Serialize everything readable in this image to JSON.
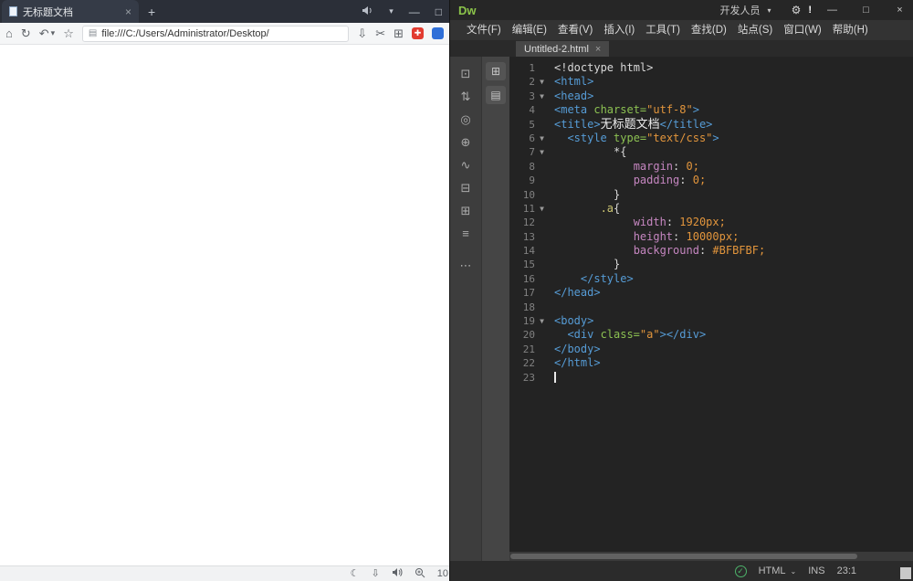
{
  "colors": {
    "dw_logo_green": "#8bc34a",
    "status_check_green": "#4db36a",
    "red_app_icon": "#e23b30",
    "blue_app_icon": "#2f6fd8",
    "browser_tabbar_bg": "#2b2f38",
    "code_background": "#232323"
  },
  "browser": {
    "tab": {
      "title": "无标题文档",
      "close_glyph": "×"
    },
    "new_tab_glyph": "+",
    "tabbar_icons": {
      "megaphone": "svg-megaphone-shape",
      "chevron": "▾",
      "minimize": "—",
      "maximize": "□"
    },
    "toolbar": {
      "icons": {
        "home": "⌂",
        "refresh": "↻",
        "undo": "↶",
        "undo_caret": "▾",
        "favorites": "☆",
        "download": "⇩",
        "scissors": "✂",
        "apps": "⊞",
        "red_app": "✚",
        "blue_app": ""
      },
      "address": {
        "page_icon": "▤",
        "url": "file:///C:/Users/Administrator/Desktop/"
      }
    },
    "bottom_bar": {
      "night_mode": "☾",
      "download": "⇩",
      "speaker": "svg-speaker-shape",
      "zoom": "svg-magnifier-plus-shape",
      "zoom_text": "10"
    }
  },
  "dw": {
    "title_bar": {
      "logo": "Dw",
      "workspace": "开发人员",
      "workspace_caret": "▾",
      "gear": "⚙",
      "notification": "!",
      "minimize": "—",
      "maximize": "□",
      "close": "×"
    },
    "menus": [
      {
        "id": "file",
        "label": "文件(F)"
      },
      {
        "id": "edit",
        "label": "编辑(E)"
      },
      {
        "id": "view",
        "label": "查看(V)"
      },
      {
        "id": "insert",
        "label": "插入(I)"
      },
      {
        "id": "tools",
        "label": "工具(T)"
      },
      {
        "id": "find",
        "label": "查找(D)"
      },
      {
        "id": "site",
        "label": "站点(S)"
      },
      {
        "id": "window",
        "label": "窗口(W)"
      },
      {
        "id": "help",
        "label": "帮助(H)"
      }
    ],
    "doc_tab": {
      "title": "Untitled-2.html",
      "close_glyph": "×"
    },
    "left_toolbar_icons": [
      {
        "name": "open-documents-icon",
        "glyph": "⊡"
      },
      {
        "name": "file-management-icon",
        "glyph": "⇅"
      },
      {
        "name": "live-view-options-icon",
        "glyph": "◎"
      },
      {
        "name": "inspect-icon",
        "glyph": "⊕"
      },
      {
        "name": "linked-files-icon",
        "glyph": "∿"
      },
      {
        "name": "apply-comment-icon",
        "glyph": "⊟"
      },
      {
        "name": "format-source-icon",
        "glyph": "⊞"
      },
      {
        "name": "outline-icon",
        "glyph": "≡"
      },
      {
        "name": "more-options-icon",
        "glyph": "⋯",
        "gap": true
      }
    ],
    "panel_icons": [
      {
        "name": "dom-panel-icon",
        "glyph": "⊞"
      },
      {
        "name": "insert-panel-icon",
        "glyph": "▤"
      }
    ],
    "code_lines": [
      {
        "n": 1,
        "fold": false,
        "indent": 0,
        "tokens": [
          {
            "t": "plain",
            "s": "<!doctype html>"
          }
        ]
      },
      {
        "n": 2,
        "fold": true,
        "indent": 0,
        "tokens": [
          {
            "t": "tag",
            "s": "<html>"
          }
        ]
      },
      {
        "n": 3,
        "fold": true,
        "indent": 0,
        "tokens": [
          {
            "t": "tag",
            "s": "<head>"
          }
        ]
      },
      {
        "n": 4,
        "fold": false,
        "indent": 0,
        "tokens": [
          {
            "t": "tag",
            "s": "<meta "
          },
          {
            "t": "attr",
            "s": "charset="
          },
          {
            "t": "str",
            "s": "\"utf-8\""
          },
          {
            "t": "tag",
            "s": ">"
          }
        ]
      },
      {
        "n": 5,
        "fold": false,
        "indent": 0,
        "tokens": [
          {
            "t": "tag",
            "s": "<title>"
          },
          {
            "t": "cjk",
            "s": "无标题文档"
          },
          {
            "t": "tag",
            "s": "</title>"
          }
        ]
      },
      {
        "n": 6,
        "fold": true,
        "indent": 2,
        "tokens": [
          {
            "t": "tag",
            "s": "<style "
          },
          {
            "t": "attr",
            "s": "type="
          },
          {
            "t": "str",
            "s": "\"text/css\""
          },
          {
            "t": "tag",
            "s": ">"
          }
        ]
      },
      {
        "n": 7,
        "fold": true,
        "indent": 9,
        "tokens": [
          {
            "t": "plain",
            "s": "*{"
          }
        ]
      },
      {
        "n": 8,
        "fold": false,
        "indent": 12,
        "tokens": [
          {
            "t": "prop",
            "s": "margin"
          },
          {
            "t": "plain",
            "s": ": "
          },
          {
            "t": "val",
            "s": "0;"
          }
        ]
      },
      {
        "n": 9,
        "fold": false,
        "indent": 12,
        "tokens": [
          {
            "t": "prop",
            "s": "padding"
          },
          {
            "t": "plain",
            "s": ": "
          },
          {
            "t": "val",
            "s": "0;"
          }
        ]
      },
      {
        "n": 10,
        "fold": false,
        "indent": 9,
        "tokens": [
          {
            "t": "plain",
            "s": "}"
          }
        ]
      },
      {
        "n": 11,
        "fold": true,
        "indent": 7,
        "tokens": [
          {
            "t": "sel",
            "s": ".a"
          },
          {
            "t": "plain",
            "s": "{"
          }
        ]
      },
      {
        "n": 12,
        "fold": false,
        "indent": 12,
        "tokens": [
          {
            "t": "prop",
            "s": "width"
          },
          {
            "t": "plain",
            "s": ": "
          },
          {
            "t": "val",
            "s": "1920px;"
          }
        ]
      },
      {
        "n": 13,
        "fold": false,
        "indent": 12,
        "tokens": [
          {
            "t": "prop",
            "s": "height"
          },
          {
            "t": "plain",
            "s": ": "
          },
          {
            "t": "val",
            "s": "10000px;"
          }
        ]
      },
      {
        "n": 14,
        "fold": false,
        "indent": 12,
        "tokens": [
          {
            "t": "prop",
            "s": "background"
          },
          {
            "t": "plain",
            "s": ": "
          },
          {
            "t": "val",
            "s": "#BFBFBF;"
          }
        ]
      },
      {
        "n": 15,
        "fold": false,
        "indent": 9,
        "tokens": [
          {
            "t": "plain",
            "s": "}"
          }
        ]
      },
      {
        "n": 16,
        "fold": false,
        "indent": 4,
        "tokens": [
          {
            "t": "tag",
            "s": "</style>"
          }
        ]
      },
      {
        "n": 17,
        "fold": false,
        "indent": 0,
        "tokens": [
          {
            "t": "tag",
            "s": "</head>"
          }
        ]
      },
      {
        "n": 18,
        "fold": false,
        "indent": 0,
        "tokens": []
      },
      {
        "n": 19,
        "fold": true,
        "indent": 0,
        "tokens": [
          {
            "t": "tag",
            "s": "<body>"
          }
        ]
      },
      {
        "n": 20,
        "fold": false,
        "indent": 2,
        "tokens": [
          {
            "t": "tag",
            "s": "<div "
          },
          {
            "t": "attr",
            "s": "class="
          },
          {
            "t": "str",
            "s": "\"a\""
          },
          {
            "t": "tag",
            "s": "></div>"
          }
        ]
      },
      {
        "n": 21,
        "fold": false,
        "indent": 0,
        "tokens": [
          {
            "t": "tag",
            "s": "</body>"
          }
        ]
      },
      {
        "n": 22,
        "fold": false,
        "indent": 0,
        "tokens": [
          {
            "t": "tag",
            "s": "</html>"
          }
        ]
      },
      {
        "n": 23,
        "fold": false,
        "indent": 0,
        "caret": true,
        "tokens": []
      }
    ],
    "status_bar": {
      "check_glyph": "✓",
      "doc_type": "HTML",
      "doc_type_caret": "⌄",
      "insert_mode": "INS",
      "cursor_position": "23:1"
    }
  }
}
